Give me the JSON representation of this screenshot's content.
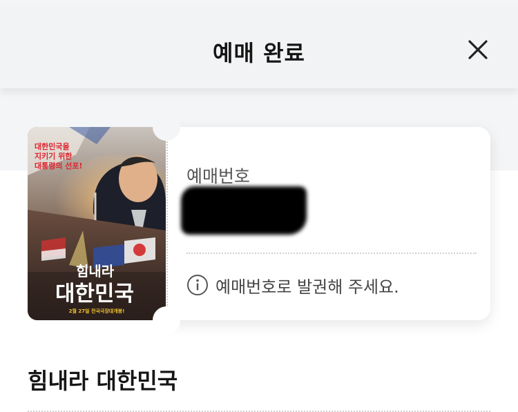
{
  "header": {
    "title": "예매 완료",
    "close_icon": "close-icon"
  },
  "ticket": {
    "poster": {
      "tagline": [
        "대한민국을",
        "지키기 위한",
        "대통령의 선포!"
      ],
      "title_line1": "힘내라",
      "title_line2": "대한민국",
      "release_note": "2월 27일 전국극장대개봉!"
    },
    "booking_number_label": "예매번호",
    "booking_number_value": "",
    "info_icon": "info-icon",
    "info_text": "예매번호로 발권해 주세요."
  },
  "movie": {
    "title": "힘내라 대한민국"
  },
  "colors": {
    "header_bg": "#f2f3f5",
    "page_band_bg": "#f4f5f7",
    "ticket_bg": "#ffffff",
    "poster_title_color": "#ffffff",
    "poster_tagline_color": "#e0232e"
  }
}
